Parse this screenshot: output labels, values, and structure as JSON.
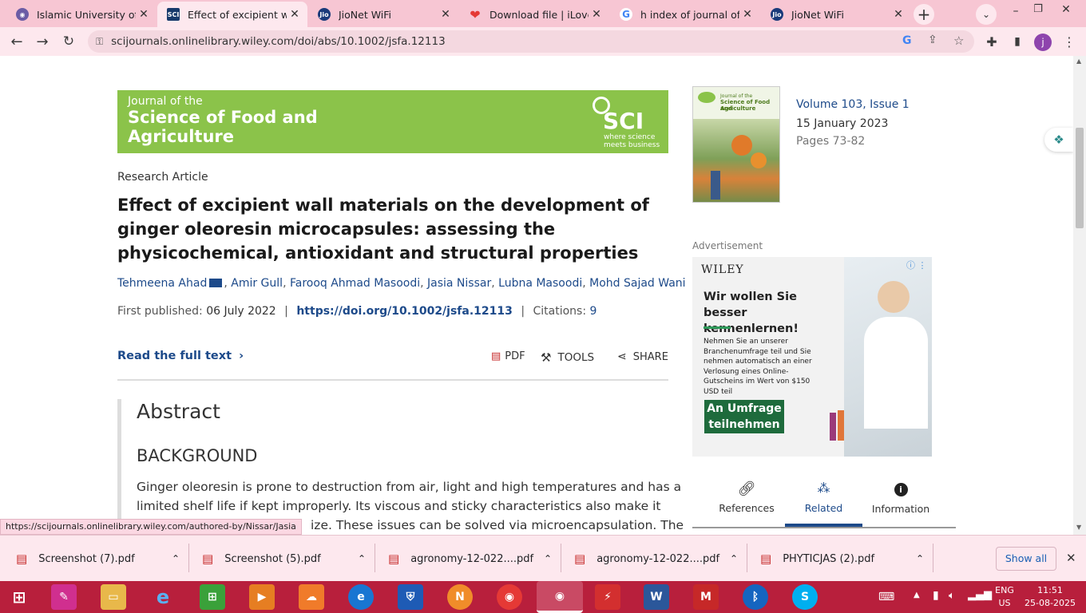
{
  "browser": {
    "tabs": [
      {
        "title": "Islamic University of Sc",
        "favicon": "globe-icon",
        "active": false
      },
      {
        "title": "Effect of excipient wall",
        "favicon": "sci-icon",
        "active": true
      },
      {
        "title": "JioNet WiFi",
        "favicon": "jio-icon",
        "active": false
      },
      {
        "title": "Download file | iLovePD",
        "favicon": "heart-icon",
        "active": false
      },
      {
        "title": "h index of journal of sc",
        "favicon": "google-icon",
        "active": false
      },
      {
        "title": "JioNet WiFi",
        "favicon": "jio-icon",
        "active": false
      }
    ],
    "url": "scijournals.onlinelibrary.wiley.com/doi/abs/10.1002/jsfa.12113",
    "profile_initial": "j",
    "status_url": "https://scijournals.onlinelibrary.wiley.com/authored-by/Nissar/Jasia"
  },
  "journal": {
    "banner_line1": "Journal of the",
    "banner_line2": "Science of Food and",
    "banner_line3": "Agriculture",
    "sci_logo": "SCI",
    "sci_tagline1": "where science",
    "sci_tagline2": "meets business",
    "cover_title1": "Journal of the",
    "cover_title2": "Science of Food and",
    "cover_title3": "Agriculture",
    "volume": "Volume 103, Issue 1",
    "date": "15 January 2023",
    "pages": "Pages 73-82"
  },
  "article": {
    "type": "Research Article",
    "title": "Effect of excipient wall materials on the development of ginger oleoresin microcapsules: assessing the physicochemical, antioxidant and structural properties",
    "authors": [
      "Tehmeena Ahad",
      "Amir Gull",
      "Farooq Ahmad Masoodi",
      "Jasia Nissar",
      "Lubna Masoodi",
      "Mohd Sajad Wani"
    ],
    "first_published_label": "First published:",
    "first_published": "06 July 2022",
    "doi": "https://doi.org/10.1002/jsfa.12113",
    "citations_label": "Citations:",
    "citations": "9",
    "read_full_text": "Read the full text",
    "pdf_label": "PDF",
    "tools_label": "TOOLS",
    "share_label": "SHARE",
    "abstract_heading": "Abstract",
    "background_heading": "BACKGROUND",
    "abstract_line1": "Ginger oleoresin is prone to destruction from air, light and high temperatures and has a",
    "abstract_line2": "limited shelf life if kept improperly. Its viscous and sticky characteristics also make it",
    "abstract_line3_visible": "ize. These issues can be solved via microencapsulation. The"
  },
  "ad": {
    "label": "Advertisement",
    "brand": "WILEY",
    "headline": "Wir wollen Sie besser kennenlernen!",
    "body": "Nehmen Sie an unserer Branchenumfrage teil und Sie nehmen automatisch an einer Verlosung eines Online-Gutscheins im Wert von $150 USD teil",
    "cta": "An Umfrage teilnehmen"
  },
  "sidebar_tabs": [
    {
      "label": "References",
      "icon": "link-icon",
      "active": false
    },
    {
      "label": "Related",
      "icon": "related-icon",
      "active": true
    },
    {
      "label": "Information",
      "icon": "info-icon",
      "active": false
    }
  ],
  "downloads": {
    "items": [
      {
        "name": "Screenshot (7).pdf"
      },
      {
        "name": "Screenshot (5).pdf"
      },
      {
        "name": "agronomy-12-022....pdf"
      },
      {
        "name": "agronomy-12-022....pdf"
      },
      {
        "name": "PHYTICJAS (2).pdf"
      }
    ],
    "show_all": "Show all"
  },
  "taskbar": {
    "lang_line1": "ENG",
    "lang_line2": "US",
    "time": "11:51",
    "date": "25-08-2025"
  },
  "colors": {
    "tab_strip": "#f7c6d3",
    "toolbar": "#fde8ee",
    "banner_green": "#8bc34a",
    "link_blue": "#1d4a8a",
    "ad_green": "#1e6b3c",
    "taskbar": "#b81f3c"
  }
}
